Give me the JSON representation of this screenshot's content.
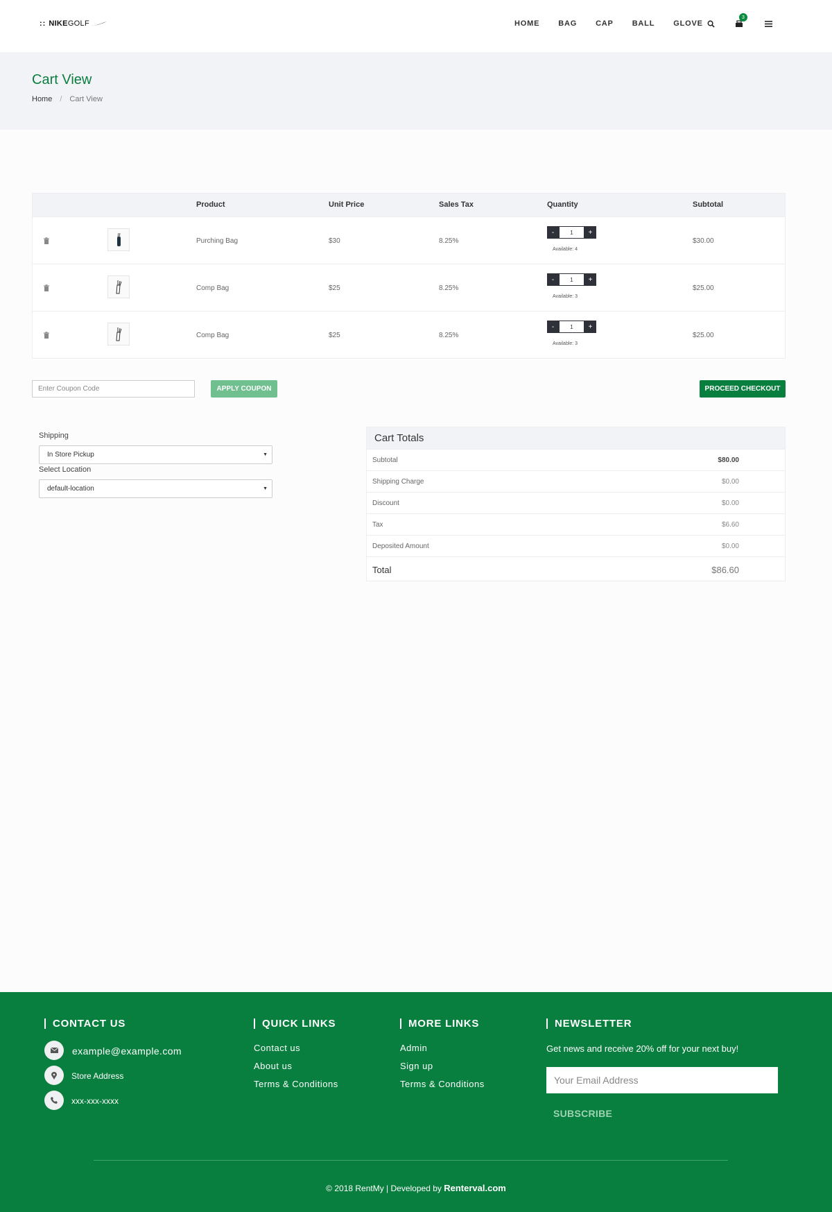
{
  "header": {
    "logo": {
      "dots": "::",
      "nike": "NIKE",
      "golf": "GOLF"
    },
    "nav": [
      "HOME",
      "BAG",
      "CAP",
      "BALL",
      "GLOVE"
    ],
    "cart_count": "3"
  },
  "banner": {
    "title": "Cart View",
    "breadcrumb": {
      "home": "Home",
      "separator": "/",
      "current": "Cart View"
    }
  },
  "cart": {
    "columns": {
      "product": "Product",
      "unit_price": "Unit Price",
      "sales_tax": "Sales Tax",
      "quantity": "Quantity",
      "subtotal": "Subtotal"
    },
    "rows": [
      {
        "product": "Purching Bag",
        "unit_price": "$30",
        "sales_tax": "8.25%",
        "qty": "1",
        "minus": "-",
        "plus": "+",
        "available": "Available: 4",
        "subtotal": "$30.00"
      },
      {
        "product": "Comp Bag",
        "unit_price": "$25",
        "sales_tax": "8.25%",
        "qty": "1",
        "minus": "-",
        "plus": "+",
        "available": "Available: 3",
        "subtotal": "$25.00"
      },
      {
        "product": "Comp Bag",
        "unit_price": "$25",
        "sales_tax": "8.25%",
        "qty": "1",
        "minus": "-",
        "plus": "+",
        "available": "Available: 3",
        "subtotal": "$25.00"
      }
    ]
  },
  "coupon": {
    "placeholder": "Enter Coupon Code",
    "apply_label": "APPLY COUPON",
    "checkout_label": "PROCEED CHECKOUT"
  },
  "shipping": {
    "shipping_label": "Shipping",
    "shipping_value": "In Store Pickup",
    "location_label": "Select Location",
    "location_value": "default-location"
  },
  "totals": {
    "title": "Cart Totals",
    "subtotal_label": "Subtotal",
    "subtotal": "$80.00",
    "shipping_label": "Shipping Charge",
    "shipping": "$0.00",
    "discount_label": "Discount",
    "discount": "$0.00",
    "tax_label": "Tax",
    "tax": "$6.60",
    "deposit_label": "Deposited Amount",
    "deposit": "$0.00",
    "total_label": "Total",
    "total": "$86.60"
  },
  "footer": {
    "contact": {
      "heading": "CONTACT US",
      "email": "example@example.com",
      "address": "Store Address",
      "phone": "xxx-xxx-xxxx"
    },
    "quick_links": {
      "heading": "QUICK LINKS",
      "items": [
        "Contact us",
        "About us",
        "Terms & Conditions"
      ]
    },
    "more_links": {
      "heading": "MORE LINKS",
      "items": [
        "Admin",
        "Sign up",
        "Terms & Conditions"
      ]
    },
    "newsletter": {
      "heading": "NEWSLETTER",
      "text": "Get news and receive 20% off for your next buy!",
      "placeholder": "Your Email Address",
      "button": "SUBSCRIBE"
    },
    "copyright_prefix": "© 2018 RentMy | Developed by ",
    "copyright_brand": "Renterval.com"
  },
  "colors": {
    "brand_green": "#087f3e",
    "title_green": "#0a7d3e",
    "dark_button": "#2e3138",
    "banner_bg": "#f2f3f7"
  }
}
